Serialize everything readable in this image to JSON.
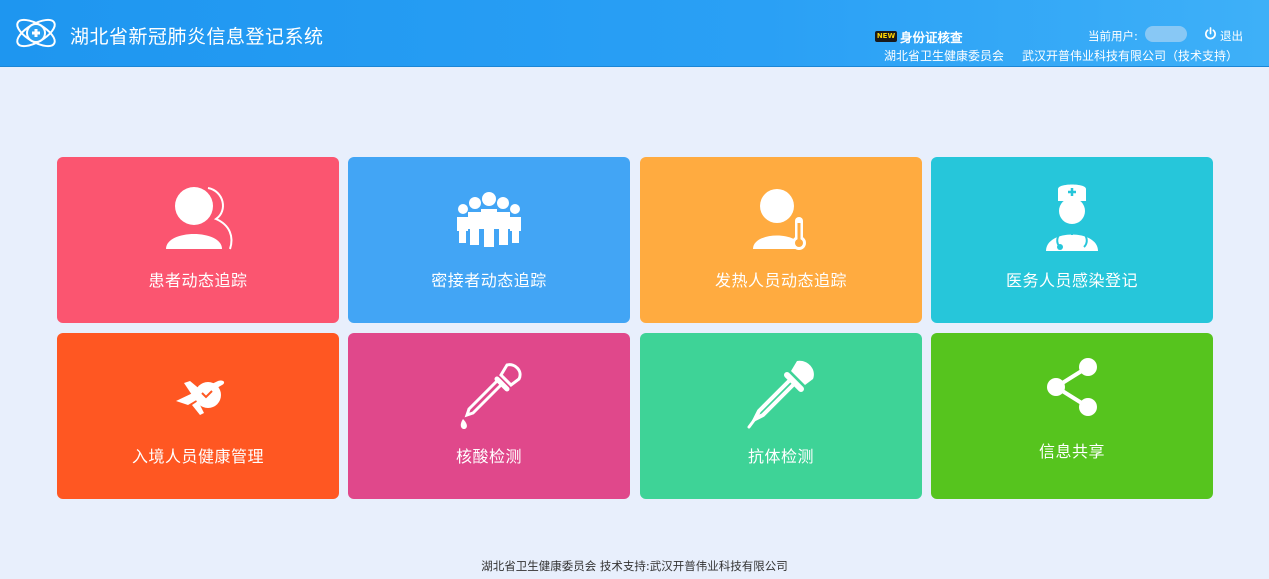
{
  "header": {
    "title": "湖北省新冠肺炎信息登记系统",
    "new_badge": "NEW",
    "id_check": "身份证核查",
    "current_user_label": "当前用户:",
    "logout": "退出",
    "org": "湖北省卫生健康委员会",
    "tech_support": "武汉开普伟业科技有限公司（技术支持）"
  },
  "tiles": [
    {
      "label": "患者动态追踪",
      "color": "#fb5570",
      "icon": "patient-icon"
    },
    {
      "label": "密接者动态追踪",
      "color": "#42a5f5",
      "icon": "group-icon"
    },
    {
      "label": "发热人员动态追踪",
      "color": "#ffab40",
      "icon": "fever-icon"
    },
    {
      "label": "医务人员感染登记",
      "color": "#26c6da",
      "icon": "doctor-icon"
    },
    {
      "label": "入境人员健康管理",
      "color": "#ff5722",
      "icon": "airplane-icon"
    },
    {
      "label": "核酸检测",
      "color": "#e0488b",
      "icon": "pipette-icon"
    },
    {
      "label": "抗体检测",
      "color": "#3ed397",
      "icon": "dropper-icon"
    },
    {
      "label": "信息共享",
      "color": "#56c41e",
      "icon": "share-icon"
    }
  ],
  "footer": "湖北省卫生健康委员会 技术支持:武汉开普伟业科技有限公司"
}
